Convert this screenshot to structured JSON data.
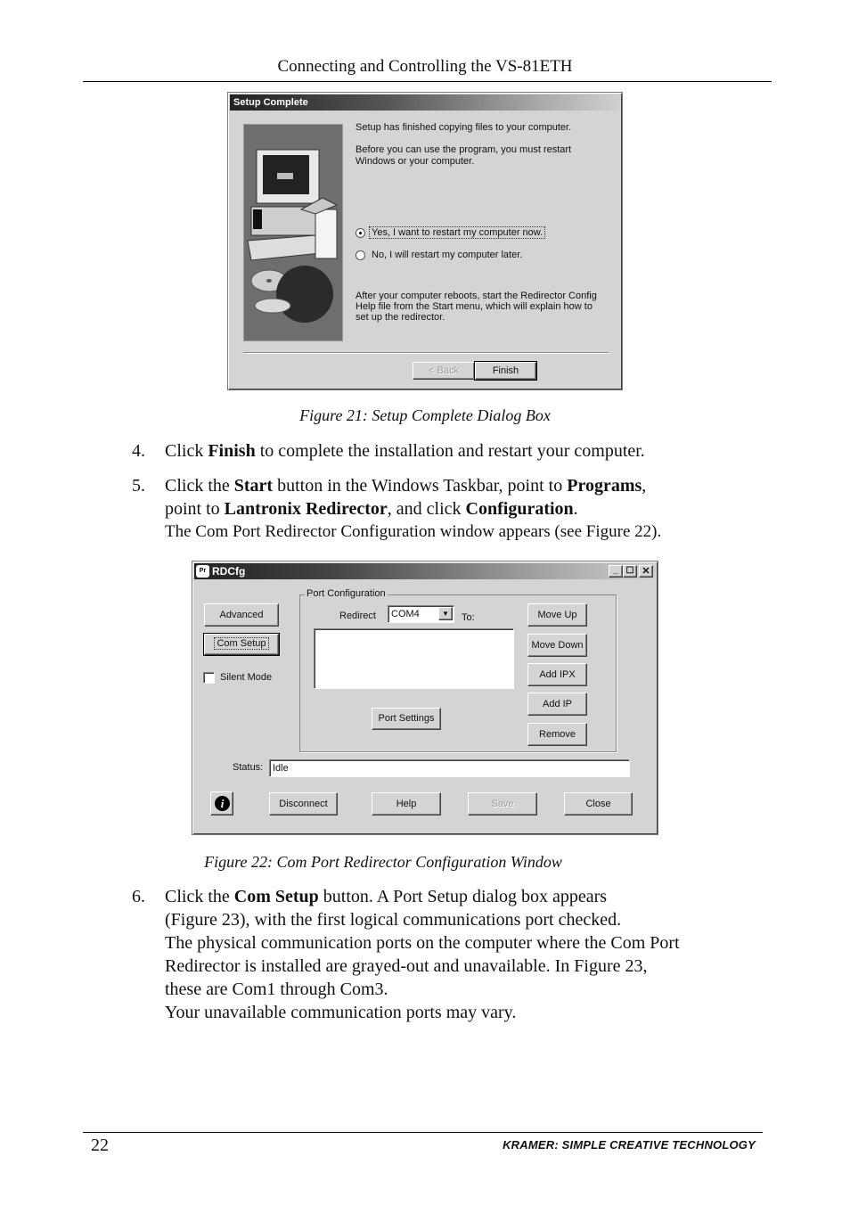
{
  "page": {
    "header": "Connecting and Controlling the VS-81ETH",
    "page_number": "22",
    "footer_brand": "KRAMER:  SIMPLE CREATIVE TECHNOLOGY"
  },
  "figure21": {
    "title": "Setup Complete",
    "text1": "Setup has finished copying files to your computer.",
    "text2": "Before you can use the program, you must restart Windows or your computer.",
    "radio_yes": "Yes, I want to restart my computer now.",
    "radio_no": "No, I will restart my computer later.",
    "radio_selected": "yes",
    "text3": "After your computer reboots, start the Redirector Config Help file from the Start menu, which will explain how to set up the redirector.",
    "back_button": "< Back",
    "finish_button": "Finish",
    "caption": "Figure 21: Setup Complete Dialog Box"
  },
  "steps": [
    {
      "num": "4.",
      "pre": "Click ",
      "b1": "Finish",
      "post": " to complete the installation and restart your computer."
    },
    {
      "num": "5.",
      "p1": "Click the ",
      "b1": "Start",
      "p2": " button in the Windows Taskbar, point to ",
      "b2": "Programs",
      "p3": ",",
      "p4": "point to ",
      "b3": "Lantronix Redirector",
      "p5": ", and click ",
      "b4": "Configuration",
      "p6": ".",
      "sub": "The Com Port Redirector Configuration window appears (see Figure 22)."
    },
    {
      "num": "6.",
      "p1": "Click the ",
      "b1": "Com Setup",
      "p2": " button. A Port Setup dialog box appears",
      "l2": "(Figure 23), with the first logical communications port checked.",
      "l3": "The physical communication ports on the computer where the Com Port",
      "l4": "Redirector is installed are grayed-out and unavailable. In Figure 23,",
      "l5": "these are Com1 through Com3.",
      "l6": "Your unavailable communication ports may vary."
    }
  ],
  "figure22": {
    "title": "RDCfg",
    "window_controls": [
      "minimize",
      "maximize",
      "close"
    ],
    "advanced_button": "Advanced",
    "com_setup_button": "Com Setup",
    "silent_mode_label": "Silent Mode",
    "silent_mode_checked": false,
    "group_label": "Port Configuration",
    "redirect_label": "Redirect",
    "redirect_value": "COM4",
    "to_label": "To:",
    "port_settings_button": "Port Settings",
    "move_up_button": "Move Up",
    "move_down_button": "Move Down",
    "add_ipx_button": "Add IPX",
    "add_ip_button": "Add IP",
    "remove_button": "Remove",
    "status_label": "Status:",
    "status_value": "Idle",
    "disconnect_button": "Disconnect",
    "help_button": "Help",
    "save_button": "Save",
    "close_button": "Close",
    "caption": "Figure 22: Com Port Redirector Configuration Window"
  }
}
